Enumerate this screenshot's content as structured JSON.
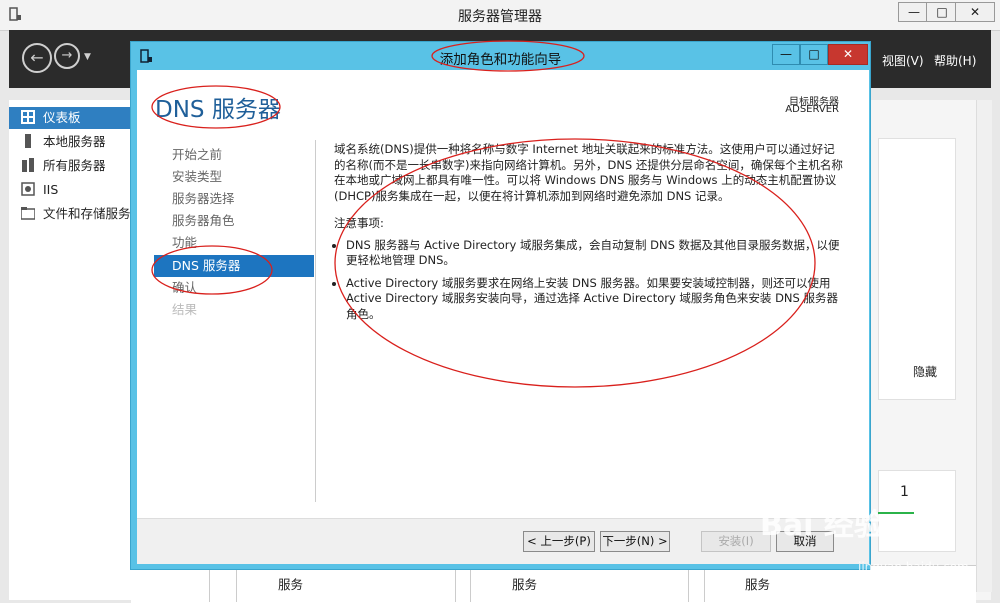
{
  "outer_window": {
    "title": "服务器管理器",
    "controls": {
      "minimize": "—",
      "maximize": "□",
      "close": "✕"
    }
  },
  "toolbar": {
    "back_glyph": "←",
    "forward_glyph": "→",
    "menu_view": "视图(V)",
    "menu_help": "帮助(H)"
  },
  "sidebar": {
    "items": [
      {
        "label": "仪表板",
        "icon": "dashboard-icon",
        "selected": true
      },
      {
        "label": "本地服务器",
        "icon": "server-icon",
        "selected": false
      },
      {
        "label": "所有服务器",
        "icon": "servers-icon",
        "selected": false
      },
      {
        "label": "IIS",
        "icon": "iis-icon",
        "selected": false
      },
      {
        "label": "文件和存储服务",
        "icon": "storage-icon",
        "selected": false
      }
    ]
  },
  "right_panel": {
    "hide_label": "隐藏",
    "count": "1"
  },
  "bottom_strip": {
    "labels": [
      "服务",
      "服务",
      "服务"
    ]
  },
  "dialog": {
    "title": "添加角色和功能向导",
    "controls": {
      "minimize": "—",
      "maximize": "□",
      "close": "✕"
    },
    "heading": "DNS 服务器",
    "target_label": "目标服务器",
    "target_server": "ADSERVER",
    "steps": [
      {
        "label": "开始之前",
        "state": "normal"
      },
      {
        "label": "安装类型",
        "state": "normal"
      },
      {
        "label": "服务器选择",
        "state": "normal"
      },
      {
        "label": "服务器角色",
        "state": "normal"
      },
      {
        "label": "功能",
        "state": "normal"
      },
      {
        "label": "DNS 服务器",
        "state": "active"
      },
      {
        "label": "确认",
        "state": "normal"
      },
      {
        "label": "结果",
        "state": "disabled"
      }
    ],
    "intro": "域名系统(DNS)提供一种将名称与数字 Internet 地址关联起来的标准方法。这使用户可以通过好记的名称(而不是一长串数字)来指向网络计算机。另外，DNS 还提供分层命名空间，确保每个主机名称在本地或广域网上都具有唯一性。可以将 Windows DNS 服务与 Windows 上的动态主机配置协议(DHCP)服务集成在一起，以便在将计算机添加到网络时避免添加 DNS 记录。",
    "notes_title": "注意事项:",
    "notes": [
      "DNS 服务器与 Active Directory 域服务集成，会自动复制 DNS 数据及其他目录服务数据，以便更轻松地管理 DNS。",
      "Active Directory 域服务要求在网络上安装 DNS 服务器。如果要安装域控制器，则还可以使用 Active Directory 域服务安装向导，通过选择 Active Directory 域服务角色来安装 DNS 服务器角色。"
    ],
    "buttons": {
      "prev": "< 上一步(P)",
      "next": "下一步(N) >",
      "install": "安装(I)",
      "cancel": "取消"
    }
  },
  "watermark": {
    "text": "Bai 经验",
    "url": "jingyan.baidu.com"
  },
  "colors": {
    "dialog_frame": "#59c2e6",
    "selection": "#1d75c0",
    "heading": "#1f5f99",
    "annotation": "#d9201c"
  }
}
